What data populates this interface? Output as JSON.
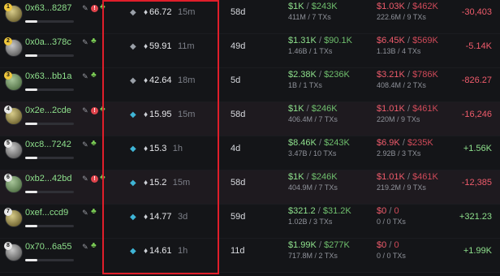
{
  "rows": [
    {
      "rank": "1",
      "address": "0x63...8287",
      "has_alert": true,
      "bar_fraction": 0.25,
      "whale": "grey",
      "amount": "66.72",
      "ago": "15m",
      "days": "58d",
      "buy": {
        "main": "$1K",
        "slash": "/",
        "alt": "$243K",
        "sub": "411M / 7 TXs"
      },
      "sell": {
        "main": "$1.03K",
        "slash": "/",
        "alt": "$462K",
        "sub": "222.6M / 9 TXs"
      },
      "pnl": "-30,403",
      "pnl_sign": "neg",
      "highlight": false
    },
    {
      "rank": "2",
      "address": "0x0a...378c",
      "has_alert": false,
      "bar_fraction": 0.25,
      "whale": "grey",
      "amount": "59.91",
      "ago": "11m",
      "days": "49d",
      "buy": {
        "main": "$1.31K",
        "slash": "/",
        "alt": "$90.1K",
        "sub": "1.46B / 1 TXs"
      },
      "sell": {
        "main": "$6.45K",
        "slash": "/",
        "alt": "$569K",
        "sub": "1.13B / 4 TXs"
      },
      "pnl": "-5.14K",
      "pnl_sign": "neg",
      "highlight": false
    },
    {
      "rank": "3",
      "address": "0x63...bb1a",
      "has_alert": false,
      "bar_fraction": 0.25,
      "whale": "grey",
      "amount": "42.64",
      "ago": "18m",
      "days": "5d",
      "buy": {
        "main": "$2.38K",
        "slash": "/",
        "alt": "$236K",
        "sub": "1B / 1 TXs"
      },
      "sell": {
        "main": "$3.21K",
        "slash": "/",
        "alt": "$786K",
        "sub": "408.4M / 2 TXs"
      },
      "pnl": "-826.27",
      "pnl_sign": "neg",
      "highlight": false
    },
    {
      "rank": "4",
      "address": "0x2e...2cde",
      "has_alert": true,
      "bar_fraction": 0.25,
      "whale": "blue",
      "amount": "15.95",
      "ago": "15m",
      "days": "58d",
      "buy": {
        "main": "$1K",
        "slash": "/",
        "alt": "$246K",
        "sub": "406.4M / 7 TXs"
      },
      "sell": {
        "main": "$1.01K",
        "slash": "/",
        "alt": "$461K",
        "sub": "220M / 9 TXs"
      },
      "pnl": "-16,246",
      "pnl_sign": "neg",
      "highlight": true
    },
    {
      "rank": "5",
      "address": "0xc8...7242",
      "has_alert": false,
      "bar_fraction": 0.25,
      "whale": "blue",
      "amount": "15.3",
      "ago": "1h",
      "days": "4d",
      "buy": {
        "main": "$8.46K",
        "slash": "/",
        "alt": "$243K",
        "sub": "3.47B / 10 TXs"
      },
      "sell": {
        "main": "$6.9K",
        "slash": "/",
        "alt": "$235K",
        "sub": "2.92B / 3 TXs"
      },
      "pnl": "+1.56K",
      "pnl_sign": "pos",
      "highlight": false
    },
    {
      "rank": "6",
      "address": "0xb2...42bd",
      "has_alert": true,
      "bar_fraction": 0.25,
      "whale": "blue",
      "amount": "15.2",
      "ago": "15m",
      "days": "58d",
      "buy": {
        "main": "$1K",
        "slash": "/",
        "alt": "$246K",
        "sub": "404.9M / 7 TXs"
      },
      "sell": {
        "main": "$1.01K",
        "slash": "/",
        "alt": "$461K",
        "sub": "219.2M / 9 TXs"
      },
      "pnl": "-12,385",
      "pnl_sign": "neg",
      "highlight": true
    },
    {
      "rank": "7",
      "address": "0xef...ccd9",
      "has_alert": false,
      "bar_fraction": 0.25,
      "whale": "blue",
      "amount": "14.77",
      "ago": "3d",
      "days": "59d",
      "buy": {
        "main": "$321.2",
        "slash": "/",
        "alt": "$31.2K",
        "sub": "1.02B / 3 TXs"
      },
      "sell": {
        "main": "$0",
        "slash": "/",
        "alt": "0",
        "sub": "0 / 0 TXs"
      },
      "pnl": "+321.23",
      "pnl_sign": "pos",
      "highlight": false
    },
    {
      "rank": "8",
      "address": "0x70...6a55",
      "has_alert": false,
      "bar_fraction": 0.25,
      "whale": "blue",
      "amount": "14.61",
      "ago": "1h",
      "days": "11d",
      "buy": {
        "main": "$1.99K",
        "slash": "/",
        "alt": "$277K",
        "sub": "717.8M / 2 TXs"
      },
      "sell": {
        "main": "$0",
        "slash": "/",
        "alt": "0",
        "sub": "0 / 0 TXs"
      },
      "pnl": "+1.99K",
      "pnl_sign": "pos",
      "highlight": false
    }
  ],
  "icons": {
    "pencil": "✎",
    "alert": "!",
    "frog": "♣",
    "whale": "◆",
    "eth": "♦"
  },
  "colors": {
    "accent_box": "#e01e2a",
    "profit": "#8ee08c",
    "loss": "#ef5b6b"
  }
}
